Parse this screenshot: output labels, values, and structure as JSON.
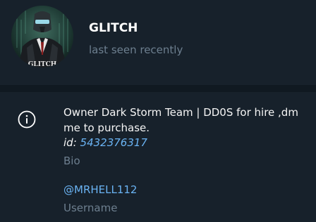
{
  "profile": {
    "name": "GLITCH",
    "status": "last seen recently",
    "avatar_caption": "GLITCH"
  },
  "info": {
    "bio_text": "Owner Dark Storm Team | DD0S for hire ,dm me to purchase.",
    "id_label": "id:",
    "id_value": "5432376317",
    "bio_caption": "Bio",
    "username": "@MRHELL112",
    "username_caption": "Username"
  },
  "icons": {
    "info": "info-circle-icon"
  },
  "colors": {
    "background": "#17212b",
    "divider": "#101921",
    "link": "#6ab3f3",
    "muted": "#6d7f8f",
    "text": "#f5f5f5"
  }
}
